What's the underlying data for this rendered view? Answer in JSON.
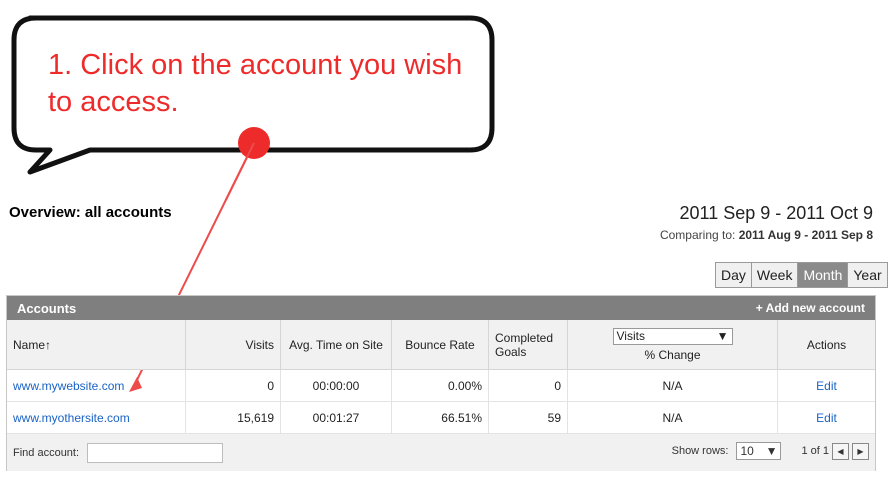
{
  "callout": {
    "text": "1. Click on the account you wish to access."
  },
  "overview": {
    "title": "Overview: all accounts"
  },
  "date_range": {
    "current": "2011 Sep 9 - 2011 Oct 9",
    "comparing_label": "Comparing to:",
    "comparing_value": "2011 Aug 9 - 2011 Sep 8"
  },
  "period_buttons": [
    "Day",
    "Week",
    "Month",
    "Year"
  ],
  "active_period": "Month",
  "panel": {
    "title": "Accounts",
    "add_link": "+ Add new account"
  },
  "table": {
    "headers": {
      "name": "Name",
      "visits": "Visits",
      "avg_time": "Avg. Time on Site",
      "bounce": "Bounce Rate",
      "goals": "Completed Goals",
      "metric_select": "Visits",
      "change": "% Change",
      "actions": "Actions"
    },
    "rows": [
      {
        "name": "www.mywebsite.com",
        "visits": "0",
        "avg_time": "00:00:00",
        "bounce": "0.00%",
        "goals": "0",
        "change": "N/A",
        "action": "Edit"
      },
      {
        "name": "www.myothersite.com",
        "visits": "15,619",
        "avg_time": "00:01:27",
        "bounce": "66.51%",
        "goals": "59",
        "change": "N/A",
        "action": "Edit"
      }
    ]
  },
  "footer": {
    "find_label": "Find account:",
    "find_value": "",
    "show_rows_label": "Show rows:",
    "show_rows_value": "10",
    "pagination": "1 of 1"
  },
  "colors": {
    "callout_text": "#ee2b2b",
    "pointer": "#ee2b2b",
    "link": "#1a63c6",
    "header_bar": "#7f7f7f"
  }
}
